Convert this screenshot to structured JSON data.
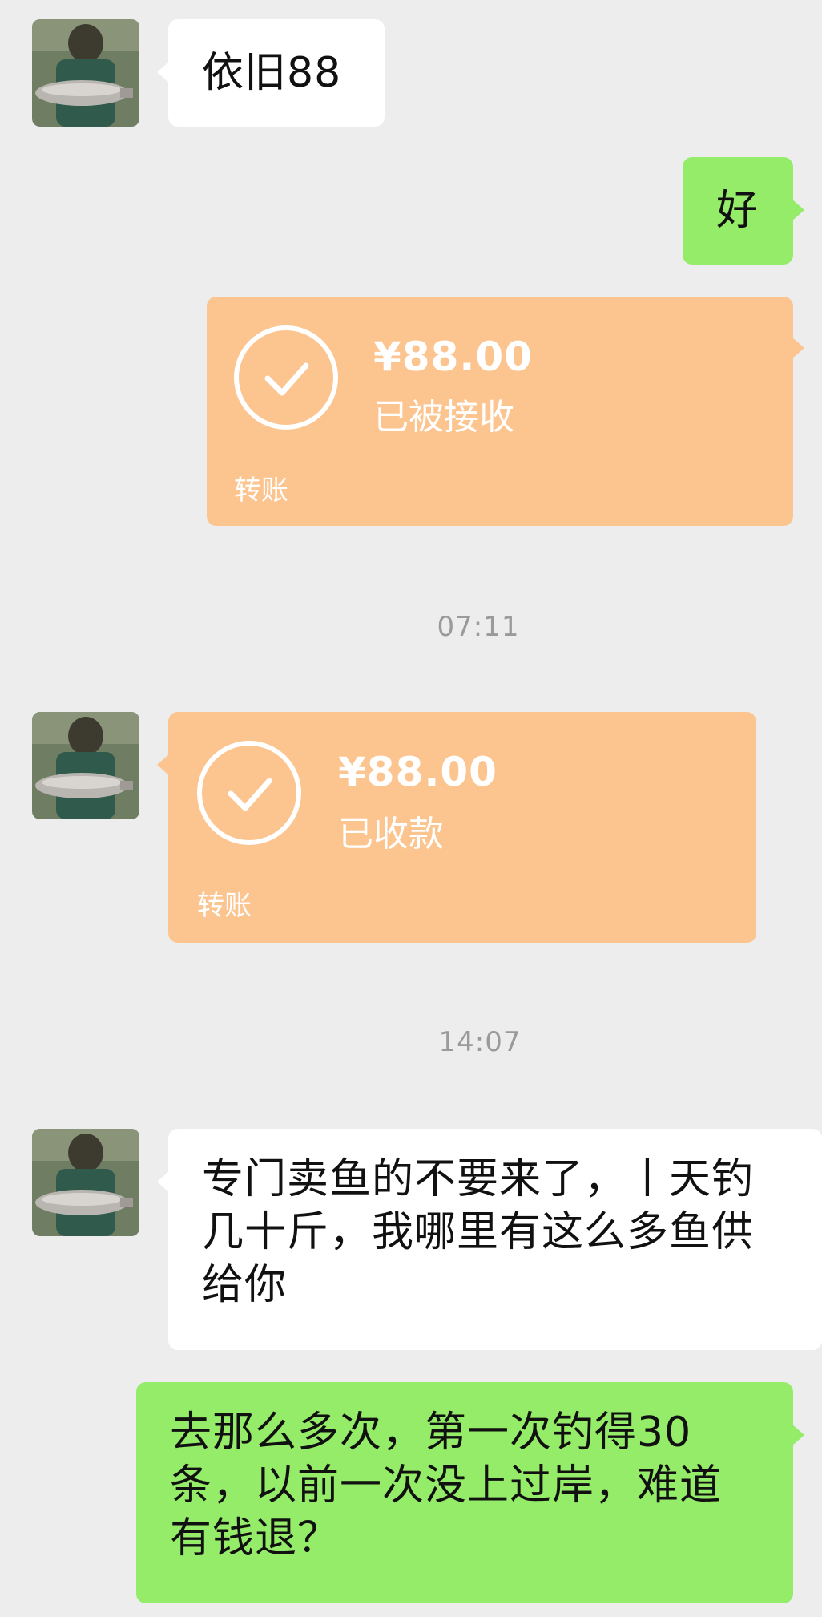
{
  "colors": {
    "background": "#ededed",
    "received_bubble": "#ffffff",
    "sent_bubble": "#95ec69",
    "transfer_card": "#fcc590",
    "timestamp_text": "#9a9a9a"
  },
  "messages": [
    {
      "side": "received",
      "type": "text",
      "text": "依旧88"
    },
    {
      "side": "sent",
      "type": "text",
      "text": "好"
    },
    {
      "side": "sent",
      "type": "transfer",
      "amount": "¥88.00",
      "status": "已被接收",
      "label": "转账",
      "icon": "check-circle-icon"
    },
    {
      "type": "timestamp",
      "text": "07:11"
    },
    {
      "side": "received",
      "type": "transfer",
      "amount": "¥88.00",
      "status": "已收款",
      "label": "转账",
      "icon": "check-circle-icon"
    },
    {
      "type": "timestamp",
      "text": "14:07"
    },
    {
      "side": "received",
      "type": "text",
      "lines": [
        "专门卖鱼的不要来了，丨天钓",
        "几十斤，我哪里有这么多鱼供",
        "给你"
      ]
    },
    {
      "side": "sent",
      "type": "text",
      "lines": [
        "去那么多次，第一次钓得30",
        "条，以前一次没上过岸，难道",
        "有钱退？"
      ]
    }
  ]
}
